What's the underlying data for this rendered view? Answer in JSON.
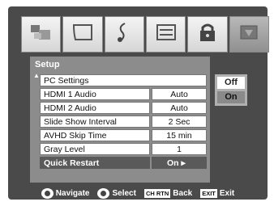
{
  "menu": {
    "title": "Setup",
    "rows": [
      {
        "label": "PC Settings",
        "value": ""
      },
      {
        "label": "HDMI 1 Audio",
        "value": "Auto"
      },
      {
        "label": "HDMI 2 Audio",
        "value": "Auto"
      },
      {
        "label": "Slide Show Interval",
        "value": "2 Sec"
      },
      {
        "label": "AVHD Skip Time",
        "value": "15 min"
      },
      {
        "label": "Gray Level",
        "value": "1"
      },
      {
        "label": "Quick Restart",
        "value": "On ▸"
      }
    ]
  },
  "options": [
    "Off",
    "On"
  ],
  "footer": {
    "navigate": "Navigate",
    "select": "Select",
    "back_key": "CH RTN",
    "back": "Back",
    "exit_key": "EXIT",
    "exit": "Exit"
  },
  "icons": [
    "picture-icon",
    "screen-icon",
    "audio-icon",
    "preferences-icon",
    "lock-icon",
    "setup-icon"
  ]
}
